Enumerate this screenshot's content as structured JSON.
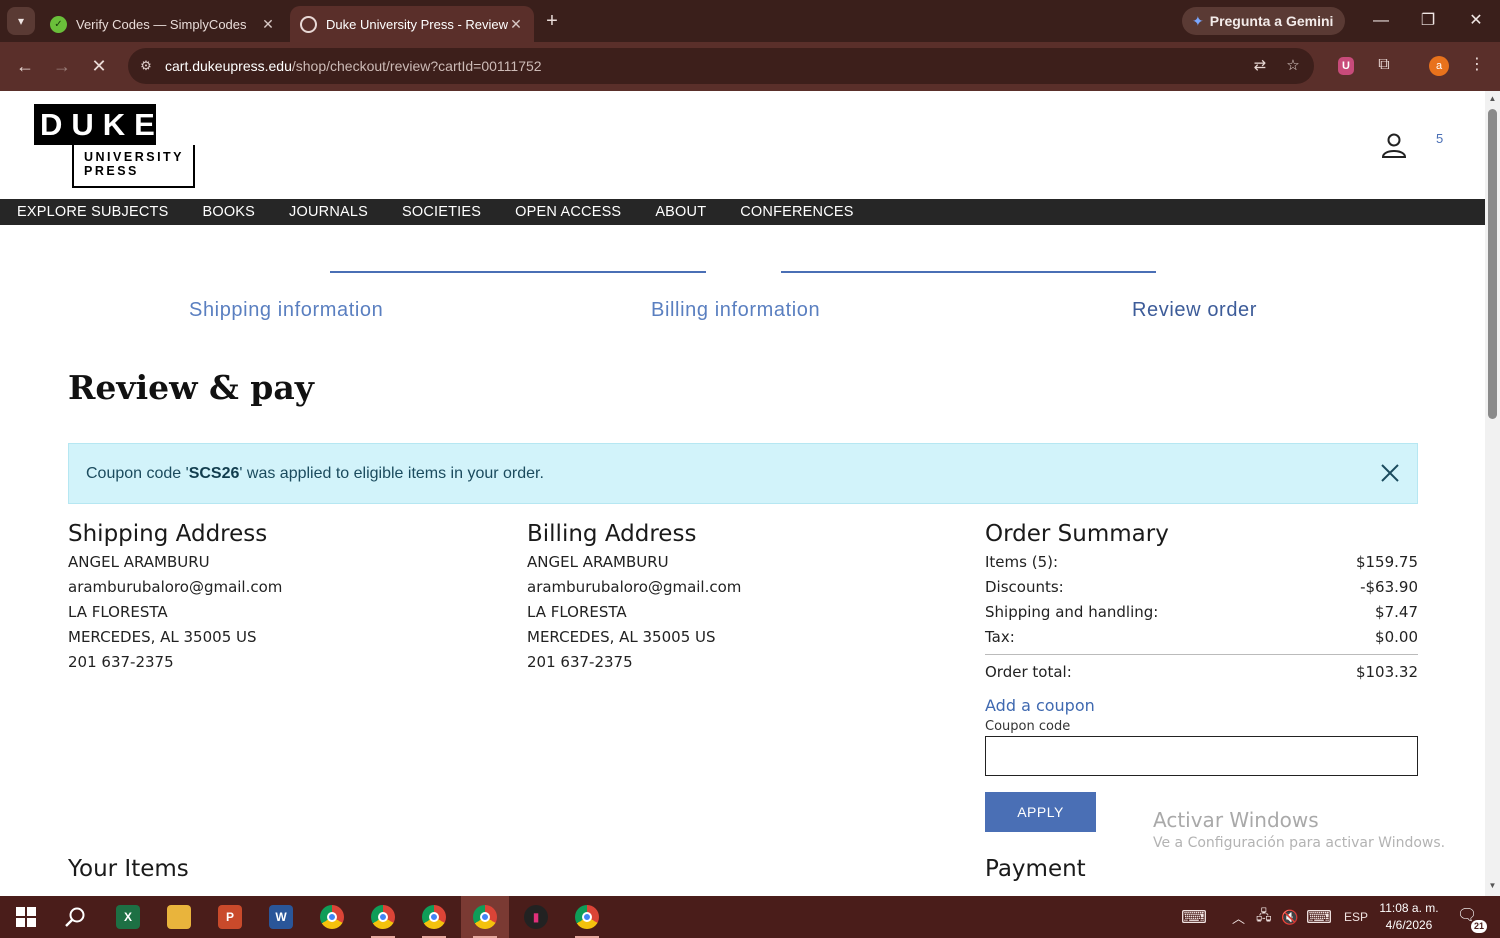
{
  "browser": {
    "tabs": [
      {
        "title": "Verify Codes — SimplyCodes",
        "active": false
      },
      {
        "title": "Duke University Press - Review",
        "active": true
      }
    ],
    "gemini_label": "Pregunta a Gemini",
    "url_host": "cart.dukeupress.edu",
    "url_path": "/shop/checkout/review?cartId=00111752",
    "profile_initial": "a"
  },
  "site": {
    "logo_main": "DUKE",
    "logo_line1": "UNIVERSITY",
    "logo_line2": "PRESS",
    "cart_count": "5",
    "nav": [
      "EXPLORE SUBJECTS",
      "BOOKS",
      "JOURNALS",
      "SOCIETIES",
      "OPEN ACCESS",
      "ABOUT",
      "CONFERENCES"
    ]
  },
  "steps": {
    "shipping": "Shipping information",
    "billing": "Billing information",
    "review": "Review order"
  },
  "page_title": "Review & pay",
  "alert": {
    "prefix": "Coupon code '",
    "code": "SCS26",
    "suffix": "' was applied to eligible items in your order."
  },
  "shipping": {
    "title": "Shipping Address",
    "name": "ANGEL ARAMBURU",
    "email": "aramburubaloro@gmail.com",
    "line1": "LA FLORESTA",
    "line2": "MERCEDES, AL 35005 US",
    "phone": "201 637-2375"
  },
  "billing": {
    "title": "Billing Address",
    "name": "ANGEL ARAMBURU",
    "email": "aramburubaloro@gmail.com",
    "line1": "LA FLORESTA",
    "line2": "MERCEDES, AL 35005 US",
    "phone": "201 637-2375"
  },
  "summary": {
    "title": "Order Summary",
    "items_label": "Items (5):",
    "items_value": "$159.75",
    "discounts_label": "Discounts:",
    "discounts_value": "-$63.90",
    "shipping_label": "Shipping and handling:",
    "shipping_value": "$7.47",
    "tax_label": "Tax:",
    "tax_value": "$0.00",
    "total_label": "Order total:",
    "total_value": "$103.32",
    "add_coupon": "Add a coupon",
    "coupon_label": "Coupon code",
    "coupon_value": "",
    "apply": "APPLY"
  },
  "your_items_title": "Your Items",
  "payment_title": "Payment",
  "watermark": {
    "line1": "Activar Windows",
    "line2": "Ve a Configuración para activar Windows."
  },
  "taskbar": {
    "lang": "ESP",
    "time": "11:08 a. m.",
    "date": "4/6/2026",
    "notifications": "21"
  },
  "colors": {
    "accent": "#4a6fb5",
    "alert_bg": "#d2f3fa",
    "nav_bg": "#262626",
    "browser_frame": "#5a2f2a"
  }
}
